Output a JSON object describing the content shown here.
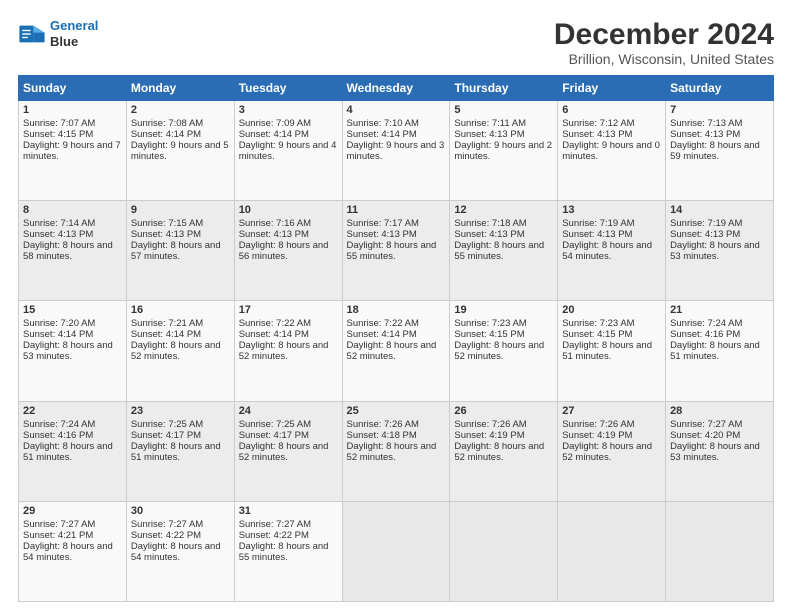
{
  "logo": {
    "line1": "General",
    "line2": "Blue"
  },
  "title": "December 2024",
  "subtitle": "Brillion, Wisconsin, United States",
  "days_of_week": [
    "Sunday",
    "Monday",
    "Tuesday",
    "Wednesday",
    "Thursday",
    "Friday",
    "Saturday"
  ],
  "weeks": [
    [
      {
        "day": 1,
        "sunrise": "Sunrise: 7:07 AM",
        "sunset": "Sunset: 4:15 PM",
        "daylight": "Daylight: 9 hours and 7 minutes."
      },
      {
        "day": 2,
        "sunrise": "Sunrise: 7:08 AM",
        "sunset": "Sunset: 4:14 PM",
        "daylight": "Daylight: 9 hours and 5 minutes."
      },
      {
        "day": 3,
        "sunrise": "Sunrise: 7:09 AM",
        "sunset": "Sunset: 4:14 PM",
        "daylight": "Daylight: 9 hours and 4 minutes."
      },
      {
        "day": 4,
        "sunrise": "Sunrise: 7:10 AM",
        "sunset": "Sunset: 4:14 PM",
        "daylight": "Daylight: 9 hours and 3 minutes."
      },
      {
        "day": 5,
        "sunrise": "Sunrise: 7:11 AM",
        "sunset": "Sunset: 4:13 PM",
        "daylight": "Daylight: 9 hours and 2 minutes."
      },
      {
        "day": 6,
        "sunrise": "Sunrise: 7:12 AM",
        "sunset": "Sunset: 4:13 PM",
        "daylight": "Daylight: 9 hours and 0 minutes."
      },
      {
        "day": 7,
        "sunrise": "Sunrise: 7:13 AM",
        "sunset": "Sunset: 4:13 PM",
        "daylight": "Daylight: 8 hours and 59 minutes."
      }
    ],
    [
      {
        "day": 8,
        "sunrise": "Sunrise: 7:14 AM",
        "sunset": "Sunset: 4:13 PM",
        "daylight": "Daylight: 8 hours and 58 minutes."
      },
      {
        "day": 9,
        "sunrise": "Sunrise: 7:15 AM",
        "sunset": "Sunset: 4:13 PM",
        "daylight": "Daylight: 8 hours and 57 minutes."
      },
      {
        "day": 10,
        "sunrise": "Sunrise: 7:16 AM",
        "sunset": "Sunset: 4:13 PM",
        "daylight": "Daylight: 8 hours and 56 minutes."
      },
      {
        "day": 11,
        "sunrise": "Sunrise: 7:17 AM",
        "sunset": "Sunset: 4:13 PM",
        "daylight": "Daylight: 8 hours and 55 minutes."
      },
      {
        "day": 12,
        "sunrise": "Sunrise: 7:18 AM",
        "sunset": "Sunset: 4:13 PM",
        "daylight": "Daylight: 8 hours and 55 minutes."
      },
      {
        "day": 13,
        "sunrise": "Sunrise: 7:19 AM",
        "sunset": "Sunset: 4:13 PM",
        "daylight": "Daylight: 8 hours and 54 minutes."
      },
      {
        "day": 14,
        "sunrise": "Sunrise: 7:19 AM",
        "sunset": "Sunset: 4:13 PM",
        "daylight": "Daylight: 8 hours and 53 minutes."
      }
    ],
    [
      {
        "day": 15,
        "sunrise": "Sunrise: 7:20 AM",
        "sunset": "Sunset: 4:14 PM",
        "daylight": "Daylight: 8 hours and 53 minutes."
      },
      {
        "day": 16,
        "sunrise": "Sunrise: 7:21 AM",
        "sunset": "Sunset: 4:14 PM",
        "daylight": "Daylight: 8 hours and 52 minutes."
      },
      {
        "day": 17,
        "sunrise": "Sunrise: 7:22 AM",
        "sunset": "Sunset: 4:14 PM",
        "daylight": "Daylight: 8 hours and 52 minutes."
      },
      {
        "day": 18,
        "sunrise": "Sunrise: 7:22 AM",
        "sunset": "Sunset: 4:14 PM",
        "daylight": "Daylight: 8 hours and 52 minutes."
      },
      {
        "day": 19,
        "sunrise": "Sunrise: 7:23 AM",
        "sunset": "Sunset: 4:15 PM",
        "daylight": "Daylight: 8 hours and 52 minutes."
      },
      {
        "day": 20,
        "sunrise": "Sunrise: 7:23 AM",
        "sunset": "Sunset: 4:15 PM",
        "daylight": "Daylight: 8 hours and 51 minutes."
      },
      {
        "day": 21,
        "sunrise": "Sunrise: 7:24 AM",
        "sunset": "Sunset: 4:16 PM",
        "daylight": "Daylight: 8 hours and 51 minutes."
      }
    ],
    [
      {
        "day": 22,
        "sunrise": "Sunrise: 7:24 AM",
        "sunset": "Sunset: 4:16 PM",
        "daylight": "Daylight: 8 hours and 51 minutes."
      },
      {
        "day": 23,
        "sunrise": "Sunrise: 7:25 AM",
        "sunset": "Sunset: 4:17 PM",
        "daylight": "Daylight: 8 hours and 51 minutes."
      },
      {
        "day": 24,
        "sunrise": "Sunrise: 7:25 AM",
        "sunset": "Sunset: 4:17 PM",
        "daylight": "Daylight: 8 hours and 52 minutes."
      },
      {
        "day": 25,
        "sunrise": "Sunrise: 7:26 AM",
        "sunset": "Sunset: 4:18 PM",
        "daylight": "Daylight: 8 hours and 52 minutes."
      },
      {
        "day": 26,
        "sunrise": "Sunrise: 7:26 AM",
        "sunset": "Sunset: 4:19 PM",
        "daylight": "Daylight: 8 hours and 52 minutes."
      },
      {
        "day": 27,
        "sunrise": "Sunrise: 7:26 AM",
        "sunset": "Sunset: 4:19 PM",
        "daylight": "Daylight: 8 hours and 52 minutes."
      },
      {
        "day": 28,
        "sunrise": "Sunrise: 7:27 AM",
        "sunset": "Sunset: 4:20 PM",
        "daylight": "Daylight: 8 hours and 53 minutes."
      }
    ],
    [
      {
        "day": 29,
        "sunrise": "Sunrise: 7:27 AM",
        "sunset": "Sunset: 4:21 PM",
        "daylight": "Daylight: 8 hours and 54 minutes."
      },
      {
        "day": 30,
        "sunrise": "Sunrise: 7:27 AM",
        "sunset": "Sunset: 4:22 PM",
        "daylight": "Daylight: 8 hours and 54 minutes."
      },
      {
        "day": 31,
        "sunrise": "Sunrise: 7:27 AM",
        "sunset": "Sunset: 4:22 PM",
        "daylight": "Daylight: 8 hours and 55 minutes."
      },
      null,
      null,
      null,
      null
    ]
  ]
}
